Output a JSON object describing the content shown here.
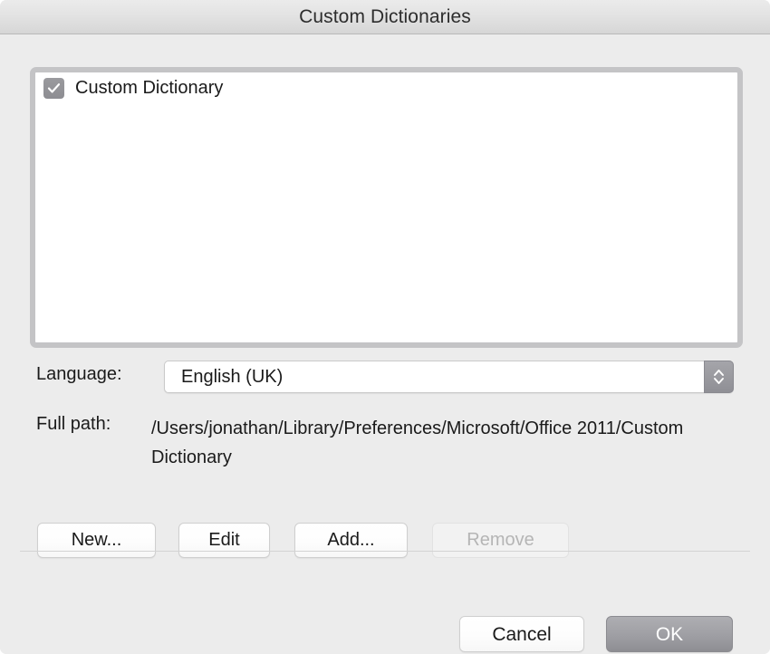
{
  "window": {
    "title": "Custom Dictionaries"
  },
  "dictionary_list": {
    "items": [
      {
        "label": "Custom Dictionary",
        "checked": true
      }
    ]
  },
  "language": {
    "label": "Language:",
    "selected": "English (UK)",
    "options": [
      "English (UK)"
    ],
    "stepper_icon": "chevron-up-down-icon"
  },
  "full_path": {
    "label": "Full path:",
    "value": "/Users/jonathan/Library/Preferences/Microsoft/Office 2011/Custom Dictionary"
  },
  "actions": {
    "new_label": "New...",
    "edit_label": "Edit",
    "add_label": "Add...",
    "remove_label": "Remove",
    "remove_disabled": true
  },
  "footer": {
    "cancel_label": "Cancel",
    "ok_label": "OK"
  },
  "colors": {
    "window_background": "#ececec",
    "titlebar_top": "#ebebeb",
    "titlebar_bottom": "#d6d6d6",
    "listbox_border": "#c4c4c6",
    "listbox_background": "#ffffff",
    "checkbox_fill": "#8d8d92",
    "checkbox_mark": "#ffffff",
    "default_button_fill": "#9a9a9f",
    "default_button_text": "#ffffff",
    "disabled_text": "#b5b5b5",
    "separator": "#d3d3d3",
    "text": "#1a1a1a"
  }
}
